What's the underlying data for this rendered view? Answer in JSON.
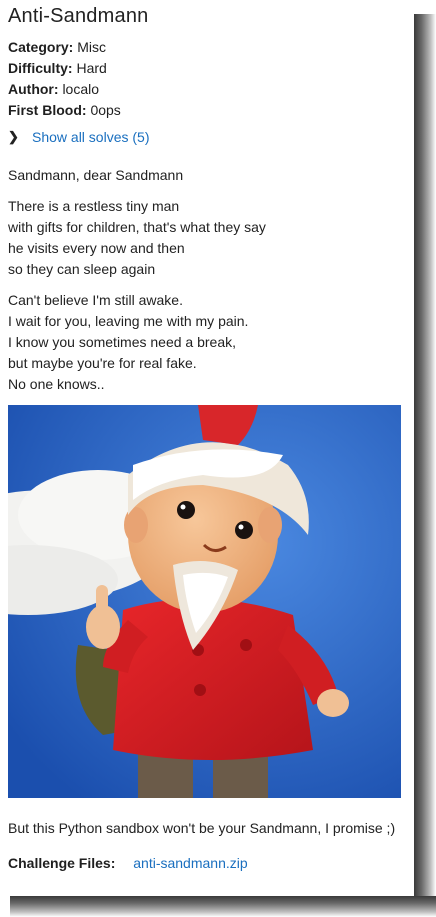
{
  "challenge": {
    "title": "Anti-Sandmann",
    "meta": [
      {
        "key": "Category:",
        "value": "Misc"
      },
      {
        "key": "Difficulty:",
        "value": "Hard"
      },
      {
        "key": "Author:",
        "value": "localo"
      },
      {
        "key": "First Blood:",
        "value": "0ops"
      }
    ],
    "solves_link": "Show all solves (5)",
    "description": [
      [
        "Sandmann, dear Sandmann"
      ],
      [
        "There is a restless tiny man",
        "with gifts for children, that's what they say",
        "he visits every now and then",
        "so they can sleep again"
      ],
      [
        "Can't believe I'm still awake.",
        "I wait for you, leaving me with my pain.",
        "I know you sometimes need a break,",
        "but maybe you're for real fake.",
        "No one knows.."
      ]
    ],
    "tagline": "But this Python sandbox won't be your Sandmann, I promise ;)",
    "files_label": "Challenge Files:",
    "file_name": "anti-sandmann.zip"
  },
  "icons": {
    "expand": "chevron-right-icon"
  }
}
